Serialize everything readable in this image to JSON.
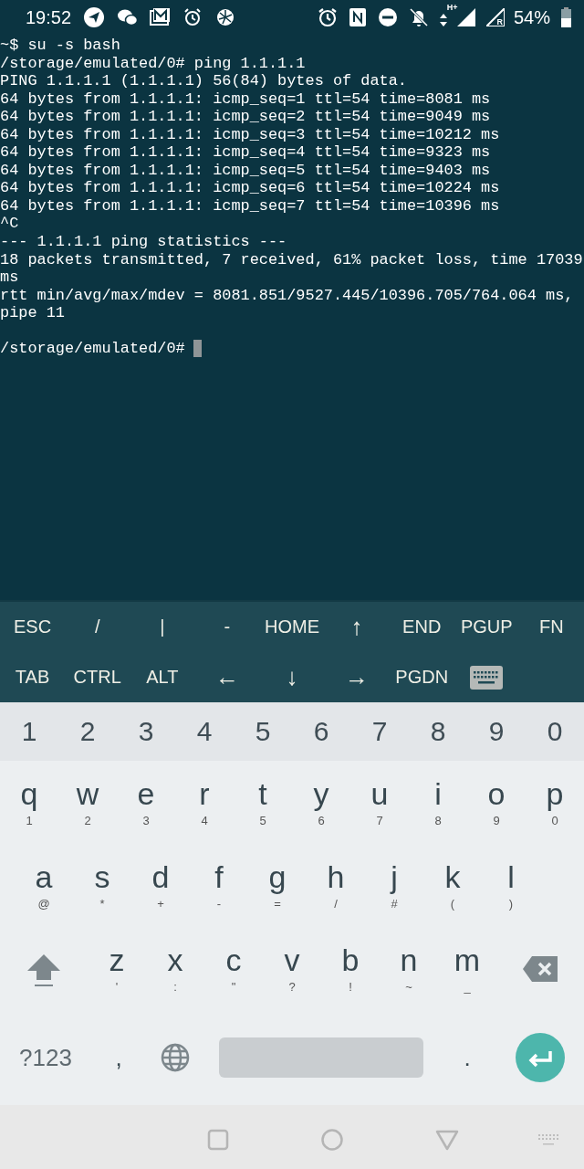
{
  "status_bar": {
    "time": "19:52",
    "network_type": "H+",
    "roaming": "R",
    "battery": "54%"
  },
  "terminal": {
    "lines": [
      "~$ su -s bash",
      "/storage/emulated/0# ping 1.1.1.1",
      "PING 1.1.1.1 (1.1.1.1) 56(84) bytes of data.",
      "64 bytes from 1.1.1.1: icmp_seq=1 ttl=54 time=8081 ms",
      "64 bytes from 1.1.1.1: icmp_seq=2 ttl=54 time=9049 ms",
      "64 bytes from 1.1.1.1: icmp_seq=3 ttl=54 time=10212 ms",
      "64 bytes from 1.1.1.1: icmp_seq=4 ttl=54 time=9323 ms",
      "64 bytes from 1.1.1.1: icmp_seq=5 ttl=54 time=9403 ms",
      "64 bytes from 1.1.1.1: icmp_seq=6 ttl=54 time=10224 ms",
      "64 bytes from 1.1.1.1: icmp_seq=7 ttl=54 time=10396 ms",
      "^C",
      "--- 1.1.1.1 ping statistics ---",
      "18 packets transmitted, 7 received, 61% packet loss, time 17039",
      "ms",
      "rtt min/avg/max/mdev = 8081.851/9527.445/10396.705/764.064 ms,",
      "pipe 11"
    ],
    "prompt": "/storage/emulated/0#",
    "cursor": true
  },
  "extra_keys": [
    [
      {
        "kind": "text",
        "label": "ESC"
      },
      {
        "kind": "text",
        "label": "/"
      },
      {
        "kind": "text",
        "label": "|"
      },
      {
        "kind": "text",
        "label": "-"
      },
      {
        "kind": "text",
        "label": "HOME"
      },
      {
        "kind": "text",
        "label": "↑"
      },
      {
        "kind": "text",
        "label": "END"
      },
      {
        "kind": "text",
        "label": "PGUP"
      },
      {
        "kind": "text",
        "label": "FN"
      }
    ],
    [
      {
        "kind": "text",
        "label": "TAB"
      },
      {
        "kind": "text",
        "label": "CTRL"
      },
      {
        "kind": "text",
        "label": "ALT"
      },
      {
        "kind": "text",
        "label": "←"
      },
      {
        "kind": "text",
        "label": "↓"
      },
      {
        "kind": "text",
        "label": "→"
      },
      {
        "kind": "text",
        "label": "PGDN"
      },
      {
        "kind": "keyboard"
      }
    ]
  ],
  "keyboard": {
    "number_row": [
      "1",
      "2",
      "3",
      "4",
      "5",
      "6",
      "7",
      "8",
      "9",
      "0"
    ],
    "letter_rows": [
      [
        {
          "key": "q",
          "hint": "1"
        },
        {
          "key": "w",
          "hint": "2"
        },
        {
          "key": "e",
          "hint": "3"
        },
        {
          "key": "r",
          "hint": "4"
        },
        {
          "key": "t",
          "hint": "5"
        },
        {
          "key": "y",
          "hint": "6"
        },
        {
          "key": "u",
          "hint": "7"
        },
        {
          "key": "i",
          "hint": "8"
        },
        {
          "key": "o",
          "hint": "9"
        },
        {
          "key": "p",
          "hint": "0"
        }
      ],
      [
        {
          "key": "a",
          "hint": "@"
        },
        {
          "key": "s",
          "hint": "*"
        },
        {
          "key": "d",
          "hint": "+"
        },
        {
          "key": "f",
          "hint": "-"
        },
        {
          "key": "g",
          "hint": "="
        },
        {
          "key": "h",
          "hint": "/"
        },
        {
          "key": "j",
          "hint": "#"
        },
        {
          "key": "k",
          "hint": "("
        },
        {
          "key": "l",
          "hint": ")"
        }
      ],
      [
        {
          "key": "z",
          "hint": "'"
        },
        {
          "key": "x",
          "hint": ":"
        },
        {
          "key": "c",
          "hint": "\""
        },
        {
          "key": "v",
          "hint": "?"
        },
        {
          "key": "b",
          "hint": "!"
        },
        {
          "key": "n",
          "hint": "~"
        },
        {
          "key": "m",
          "hint": "_"
        }
      ]
    ],
    "symbols_key": "?123",
    "comma_key": ",",
    "period_key": "."
  }
}
